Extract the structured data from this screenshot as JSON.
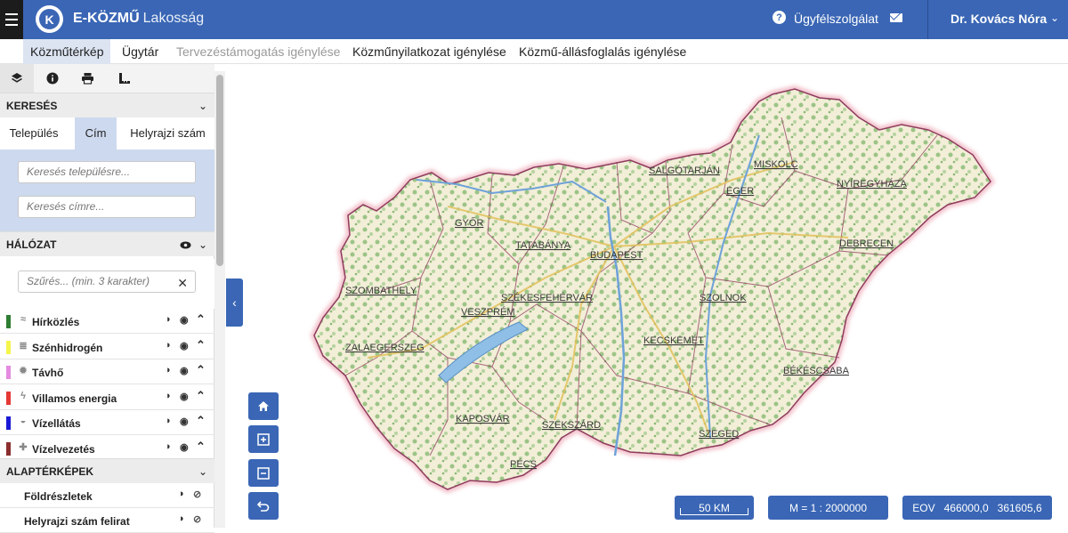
{
  "header": {
    "brand_bold": "E-KÖZMŰ",
    "brand_sub": "Lakosság",
    "logo_letter": "K",
    "help_label": "Ügyfélszolgálat",
    "user_name": "Dr. Kovács Nóra"
  },
  "nav": {
    "tabs": [
      {
        "label": "Közműtérkép",
        "active": true
      },
      {
        "label": "Ügytár"
      },
      {
        "label": "Tervezéstámogatás igénylése",
        "disabled": true
      },
      {
        "label": "Közműnyilatkozat igénylése"
      },
      {
        "label": "Közmű-állásfoglalás igénylése"
      }
    ]
  },
  "sidebar": {
    "search": {
      "title": "KERESÉS",
      "tabs": [
        "Település",
        "Cím",
        "Helyrajzi szám"
      ],
      "active_tab": "Cím",
      "settlement_placeholder": "Keresés településre...",
      "address_placeholder": "Keresés címre..."
    },
    "network": {
      "title": "HÁLÓZAT",
      "filter_placeholder": "Szűrés... (min. 3 karakter)",
      "layers": [
        {
          "name": "Hírközlés",
          "color": "#2e7d32",
          "icon": "wifi-icon"
        },
        {
          "name": "Szénhidrogén",
          "color": "#f5f54a",
          "icon": "gas-icon"
        },
        {
          "name": "Távhő",
          "color": "#e58be0",
          "icon": "heat-icon"
        },
        {
          "name": "Villamos energia",
          "color": "#e53935",
          "icon": "lightning-icon"
        },
        {
          "name": "Vízellátás",
          "color": "#1a1ad6",
          "icon": "water-drop-icon"
        },
        {
          "name": "Vízelvezetés",
          "color": "#8b2e2e",
          "icon": "drain-icon"
        }
      ]
    },
    "basemaps": {
      "title": "ALAPTÉRKÉPEK",
      "items": [
        "Földrészletek",
        "Helyrajzi szám felirat"
      ]
    }
  },
  "map": {
    "cities": [
      "SALGÓTARJÁN",
      "MISKOLC",
      "EGER",
      "NYÍREGYHÁZA",
      "GYŐR",
      "TATABÁNYA",
      "BUDAPEST",
      "DEBRECEN",
      "SZOMBATHELY",
      "SZÉKESFEHÉRVÁR",
      "SZOLNOK",
      "VESZPRÉM",
      "KECSKEMÉT",
      "ZALAEGERSZEG",
      "BÉKÉSCSABA",
      "KAPOSVÁR",
      "SZEKSZÁRD",
      "SZEGED",
      "PÉCS"
    ],
    "scale_label": "50 KM",
    "ratio_label": "M = 1 : 2000000",
    "coords_label": "EOV   466000,0   361605,6"
  },
  "colors": {
    "accent": "#3a66b5",
    "hungary_fill": "#f2eed7",
    "border": "#8e3b5e"
  }
}
